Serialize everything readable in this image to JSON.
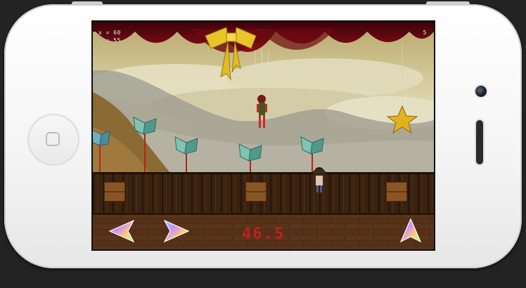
{
  "hud": {
    "x_readout": "x = 60",
    "y_readout": "x = 55",
    "score": "5"
  },
  "timer": "46.5",
  "controls": {
    "left": "move-left",
    "right": "move-right",
    "jump": "jump"
  },
  "colors": {
    "curtain": "#7a0b12",
    "sky": "#d8d1a6",
    "stage_wood": "#3b220f",
    "floor": "#4a2a14",
    "ribbon": "#e8c62a",
    "timer": "#c0201c"
  }
}
